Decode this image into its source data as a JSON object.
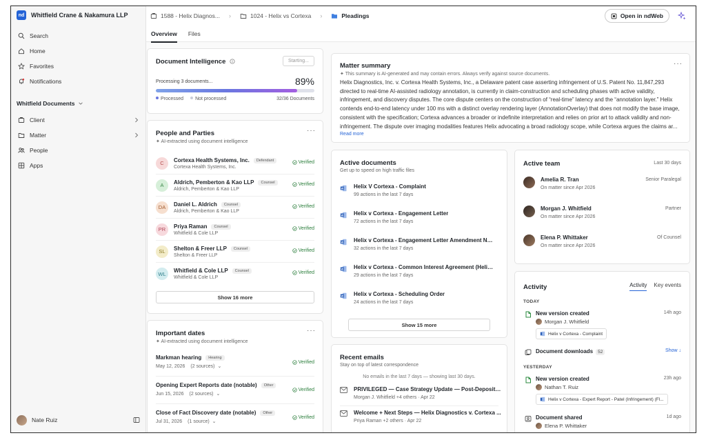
{
  "firm": {
    "logo_text": "nd",
    "name": "Whitfield Crane & Nakamura LLP"
  },
  "sidebar": {
    "nav": [
      {
        "label": "Search",
        "icon": "search-icon"
      },
      {
        "label": "Home",
        "icon": "home-icon"
      },
      {
        "label": "Favorites",
        "icon": "star-icon"
      },
      {
        "label": "Notifications",
        "icon": "bell-icon"
      }
    ],
    "section_label": "Whitfield Documents",
    "section_items": [
      {
        "label": "Client",
        "icon": "client-icon",
        "has_children": true
      },
      {
        "label": "Matter",
        "icon": "matter-icon",
        "has_children": true
      },
      {
        "label": "People",
        "icon": "people-icon",
        "has_children": false
      },
      {
        "label": "Apps",
        "icon": "apps-icon",
        "has_children": false
      }
    ],
    "user_name": "Nate Ruiz"
  },
  "breadcrumb": {
    "items": [
      {
        "label": "1588 - Helix Diagnos...",
        "icon": "client-folder-icon"
      },
      {
        "label": "1024 - Helix vs Cortexa",
        "icon": "matter-folder-icon"
      },
      {
        "label": "Pleadings",
        "icon": "folder-icon"
      }
    ]
  },
  "header": {
    "open_button": "Open in ndWeb"
  },
  "tabs": [
    "Overview",
    "Files"
  ],
  "doc_intel": {
    "title": "Document Intelligence",
    "button": "Starting...",
    "processing_text": "Processing 3 documents...",
    "percent": "89%",
    "progress": 0.89,
    "legend_processed": "Processed",
    "legend_not_processed": "Not processed",
    "count": "32/36 Documents"
  },
  "people": {
    "title": "People and Parties",
    "subtitle": "AI-extracted using document intelligence",
    "verified_label": "Verified",
    "items": [
      {
        "initials": "C",
        "name": "Cortexa Health Systems, Inc.",
        "tag": "Defendant",
        "org": "Cortexa Health Systems, Inc.",
        "bg": "#f7d9d9",
        "fg": "#b44a4a"
      },
      {
        "initials": "A",
        "name": "Aldrich, Pemberton & Kao LLP",
        "tag": "Counsel",
        "org": "Aldrich, Pemberton & Kao LLP",
        "bg": "#d6efd9",
        "fg": "#3f8a4c"
      },
      {
        "initials": "DA",
        "name": "Daniel L. Aldrich",
        "tag": "Counsel",
        "org": "Aldrich, Pemberton & Kao LLP",
        "bg": "#f6dfcf",
        "fg": "#a25b2e"
      },
      {
        "initials": "PR",
        "name": "Priya Raman",
        "tag": "Counsel",
        "org": "Whitfield & Cole LLP",
        "bg": "#f7d9dd",
        "fg": "#b14657"
      },
      {
        "initials": "SL",
        "name": "Shelton & Freer LLP",
        "tag": "Counsel",
        "org": "Shelton & Freer LLP",
        "bg": "#f3ecc9",
        "fg": "#8b7a22"
      },
      {
        "initials": "WL",
        "name": "Whitfield & Cole LLP",
        "tag": "Counsel",
        "org": "Whitfield & Cole LLP",
        "bg": "#d3ecef",
        "fg": "#2f7e8a"
      }
    ],
    "show_more": "Show 16 more"
  },
  "dates": {
    "title": "Important dates",
    "subtitle": "AI-extracted using document intelligence",
    "verified_label": "Verified",
    "items": [
      {
        "name": "Markman hearing",
        "tag": "Hearing",
        "date": "May 12, 2026",
        "sources": "(2 sources)"
      },
      {
        "name": "Opening Expert Reports date (notable)",
        "tag": "Other",
        "date": "Jun 15, 2026",
        "sources": "(2 sources)"
      },
      {
        "name": "Close of Fact Discovery date (notable)",
        "tag": "Other",
        "date": "Jul 31, 2026",
        "sources": "(1 source)"
      }
    ]
  },
  "summary": {
    "title": "Matter summary",
    "disclaimer": "This summary is AI-generated and may contain errors. Always verify against source documents.",
    "text": "Helix Diagnostics, Inc. v. Cortexa Health Systems, Inc., a Delaware patent case asserting infringement of U.S. Patent No. 11,847,293 directed to real-time AI-assisted radiology annotation, is currently in claim-construction and scheduling phases with active validity, infringement, and discovery disputes. The core dispute centers on the construction of “real-time” latency and the “annotation layer.” Helix contends end-to-end latency under 100 ms with a distinct overlay rendering layer (AnnotationOverlay) that does not modify the base image, consistent with the specification; Cortexa advances a broader or indefinite interpretation and relies on prior art to attack validity and non-infringement. The dispute over imaging modalities features Helix advocating a broad radiology scope, while Cortexa argues the claims ar...",
    "read_more": "Read more"
  },
  "active_docs": {
    "title": "Active documents",
    "subtitle": "Get up to speed on high traffic files",
    "items": [
      {
        "title": "Helix V Cortexa - Complaint",
        "meta": "99 actions in the last 7 days"
      },
      {
        "title": "Helix v Cortexa - Engagement Letter",
        "meta": "72 actions in the last 7 days"
      },
      {
        "title": "Helix v Cortexa - Engagement Letter Amendment No. 1",
        "meta": "32 actions in the last 7 days"
      },
      {
        "title": "Helix v Cortexa - Common Interest Agreement (Helix-R...",
        "meta": "29 actions in the last 7 days"
      },
      {
        "title": "Helix v Cortexa - Scheduling Order",
        "meta": "24 actions in the last 7 days"
      }
    ],
    "show_more": "Show 15 more"
  },
  "emails": {
    "title": "Recent emails",
    "subtitle": "Stay on top of latest correspondence",
    "notice": "No emails in the last 7 days — showing last 30 days.",
    "items": [
      {
        "title": "PRIVILEGED — Case Strategy Update — Post-Depositio...",
        "meta": "Morgan J. Whitfield +4 others · Apr 22"
      },
      {
        "title": "Welcome + Next Steps — Helix Diagnostics v. Cortexa ...",
        "meta": "Priya Raman +2 others · Apr 22"
      }
    ]
  },
  "team": {
    "title": "Active team",
    "period": "Last 30 days",
    "items": [
      {
        "name": "Amelia R. Tran",
        "since": "On matter since Apr 2026",
        "role": "Senior Paralegal"
      },
      {
        "name": "Morgan J. Whitfield",
        "since": "On matter since Apr 2026",
        "role": "Partner"
      },
      {
        "name": "Elena P. Whittaker",
        "since": "On matter since Apr 2026",
        "role": "Of Counsel"
      }
    ]
  },
  "activity": {
    "title": "Activity",
    "tabs": [
      "Activity",
      "Key events"
    ],
    "today_label": "TODAY",
    "yesterday_label": "YESTERDAY",
    "today": [
      {
        "title": "New version created",
        "time": "14h ago",
        "by": "Morgan J. Whitfield",
        "chip": "Helix v Cortexa - Complaint"
      },
      {
        "title": "Document downloads",
        "count": "52",
        "show": "Show ↓"
      }
    ],
    "yesterday": [
      {
        "title": "New version created",
        "time": "23h ago",
        "by": "Nathan T. Ruiz",
        "chip": "Helix v Cortexa - Expert Report - Patel (Infringement) (Fl..."
      },
      {
        "title": "Document shared",
        "time": "1d ago",
        "by": "Elena P. Whittaker"
      }
    ]
  },
  "colors": {
    "accent": "#2463d6",
    "verified": "#2a7d3b"
  }
}
